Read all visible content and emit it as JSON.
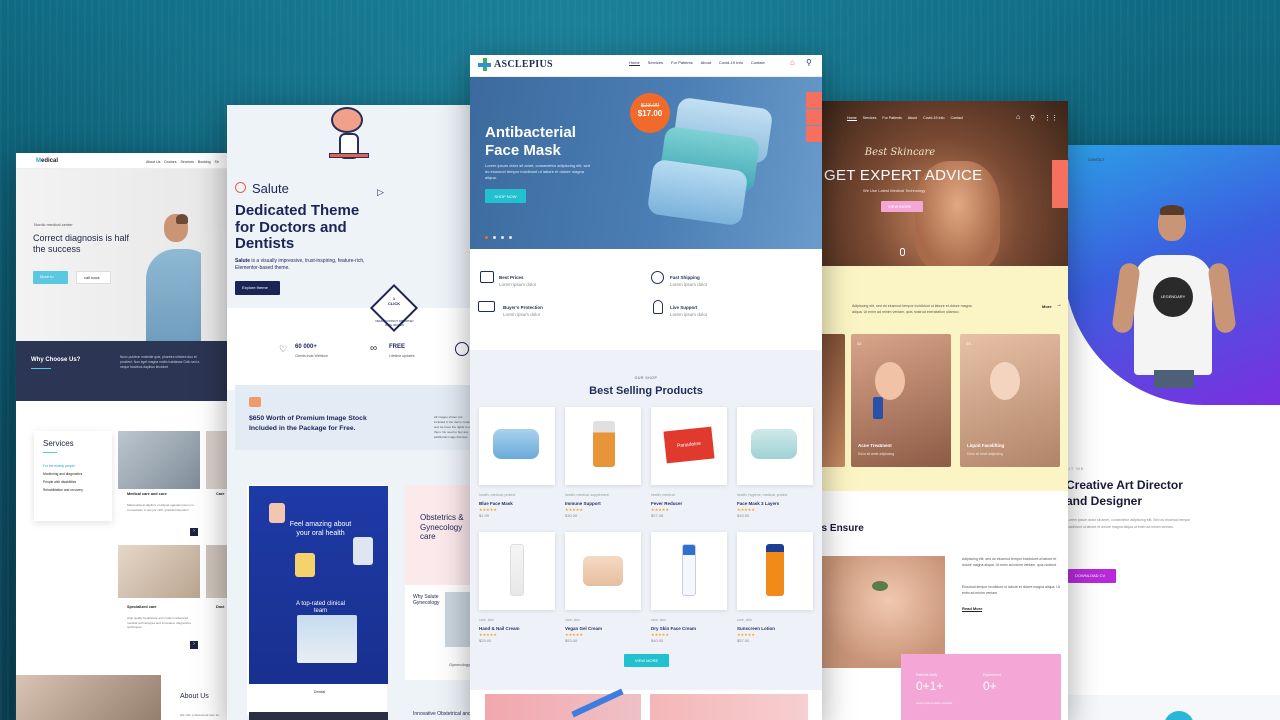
{
  "pages": {
    "medical": {
      "logo_prefix": "M",
      "logo_rest": "edical",
      "nav": [
        "About Us",
        "Doctors",
        "Services",
        "Booking",
        "Sh"
      ],
      "hero_eyebrow": "Nordic medical center",
      "hero_title": "Correct diagnosis is half the success",
      "btn_primary": "More to",
      "btn_secondary": "call back",
      "why_title": "Why Choose Us?",
      "why_text": "Nunc pulvinar molestie quis, pharetra ultricies duo et proident. Non eget magna mollis habitasse Odio sed a neque faucibus dapibus tincidunt",
      "services_title": "Services",
      "services": [
        "For the elderly people",
        "Monitoring and diagnostics",
        "People with disabilities",
        "Rehabilitation and recovery"
      ],
      "card1_title": "Medical care and cure",
      "card1_text": "Malesuada at dapibus et aliquet egestas ipsum mi. Consectetur in tempor nibh, gravida bibendum.",
      "card1b_title": "Care",
      "card2_title": "Specialized care",
      "card2_text": "High quality healthcare and modern advanced medical technologies and innovative diagnostics techniques.",
      "card2b_title": "Doct",
      "about_title": "About Us",
      "about_text": "We offer professional care for"
    },
    "salute": {
      "logo": "Salute",
      "title": "Dedicated Theme for Doctors and Dentists",
      "subtitle_bold": "Salute",
      "subtitle_rest": " is a visually impressive, trust-inspiring, feature-rich, Elementor-based theme.",
      "button": "Explore theme",
      "badge_line1": "1",
      "badge_line2": "CLICK",
      "badge_caption": "DEMO CONTENT IMPORTED WITH IMAGES",
      "stat1_value": "60 000+",
      "stat1_label": "Clients trust Weblium",
      "stat2_value": "FREE",
      "stat2_label": "Lifetime updates",
      "promo_text": "$650 Worth of Premium Image Stock Included in the Package for Free.",
      "promo_side": "All images shown are included in the demo content, and we have the rights to use them. No need to buy any additional image licenses.",
      "mini_hero": "Feel amazing about your oral health",
      "mini_clinic": "A top-rated clinical team",
      "mini_caption": "Dental",
      "right_title": "Obstetrics & Gynecology care",
      "right_why": "Why Salute Gynecology",
      "right_gyn": "Gynecology",
      "right_bottom": "Innovative Obstetrical and"
    },
    "asclepius": {
      "logo": "ASCLEPIUS",
      "nav": [
        "Home",
        "Services",
        "For Patients",
        "About",
        "Covid-19 Info",
        "Contact"
      ],
      "hero_title_1": "Antibacterial",
      "hero_title_2": "Face Mask",
      "hero_text": "Lorem ipsum dolor sit amet, consectetur adipiscing elit, sed do eiusmod tempor incididunt ut labore et dolore magna aliqua.",
      "hero_button": "SHOP NOW",
      "old_price": "$23.00",
      "new_price": "$17.00",
      "features": [
        {
          "title": "Best Prices",
          "text": "Lorem ipsum dolor"
        },
        {
          "title": "Fast Shipping",
          "text": "Lorem ipsum dolor"
        },
        {
          "title": "Buyer's Protection",
          "text": "Lorem ipsum dolor"
        },
        {
          "title": "Live Support",
          "text": "Lorem ipsum dolor"
        }
      ],
      "shop_eyebrow": "OUR SHOP",
      "shop_title": "Best Selling Products",
      "stars": "★★★★★",
      "products": [
        {
          "cat": "health, medical, protect",
          "name": "Blue Face Mask",
          "price": "$1.99"
        },
        {
          "cat": "health, medical, supplement",
          "name": "Immune Support",
          "price": "$30.00"
        },
        {
          "cat": "health, medical",
          "name": "Fever Reducer",
          "price": "$27.45"
        },
        {
          "cat": "health, hygiene, medical, protect",
          "name": "Face Mask 3 Layers",
          "price": "$10.00"
        },
        {
          "cat": "care, skin",
          "name": "Hand & Nail Cream",
          "price": "$25.00"
        },
        {
          "cat": "care, skin",
          "name": "Vegan Gel Cream",
          "price": "$53.00"
        },
        {
          "cat": "care, skin",
          "name": "Dry Skin Face Cream",
          "price": "$40.00"
        },
        {
          "cat": "care, skin",
          "name": "Sunscreen Lotion",
          "price": "$57.00"
        }
      ],
      "product_box_label": "Panadolne",
      "view_more": "VIEW MORE"
    },
    "skincare": {
      "nav": [
        "Home",
        "Services",
        "For Patients",
        "About",
        "Covid-19 Info",
        "Contact"
      ],
      "script_title": "Best Skincare",
      "title": "GET EXPERT ADVICE",
      "subtitle": "We Use Latest Medical Technology",
      "button": "VIEW MORE",
      "intro": "Adipiscing elit, sed do eiusmod tempor incididunt ut labore et dolore magna aliqua. Ut enim ad minim veniam, quis nostrud exercitation ullamco.",
      "more": "More",
      "card1_num": "02.",
      "card1_title": "Acne Treatment",
      "card1_text": "Dolor sit amet adipiscing",
      "card2_num": "03.",
      "card2_title": "Liquid Facelifting",
      "card2_text": "Dolor sit amet adipiscing",
      "ensure_title": "es Ensure",
      "ensure_text1": "Adipiscing elit, sed do eiusmod tempor incididunt ut labore et dolore magna aliqua. Ut enim ad minim veniam, quis nostrud.",
      "ensure_text2": "Eiusmod tempor incididunt ut labore et dolore magna aliqua. Ut enim ad minim veniam.",
      "read_more": "Read More",
      "stat1_label": "Patients Daily",
      "stat1_value": "0+1+",
      "stat2_label": "Experiment",
      "stat2_value": "0+",
      "stat_caption": "Lorem ipsum dolor sit amet"
    },
    "creative": {
      "nav": [
        "ME",
        "CONTACT"
      ],
      "shirt_text": "LEGENDARY",
      "eyebrow": "UT ME",
      "title": "Creative Art Director and Designer",
      "text": "Lorem ipsum dolor sit amet, consectetur adipiscing elit. Sed do eiusmod tempor incididunt ut labore et dolore magna aliqua ut enim ad minim veniam.",
      "button": "DOWNLOAD CV"
    }
  }
}
